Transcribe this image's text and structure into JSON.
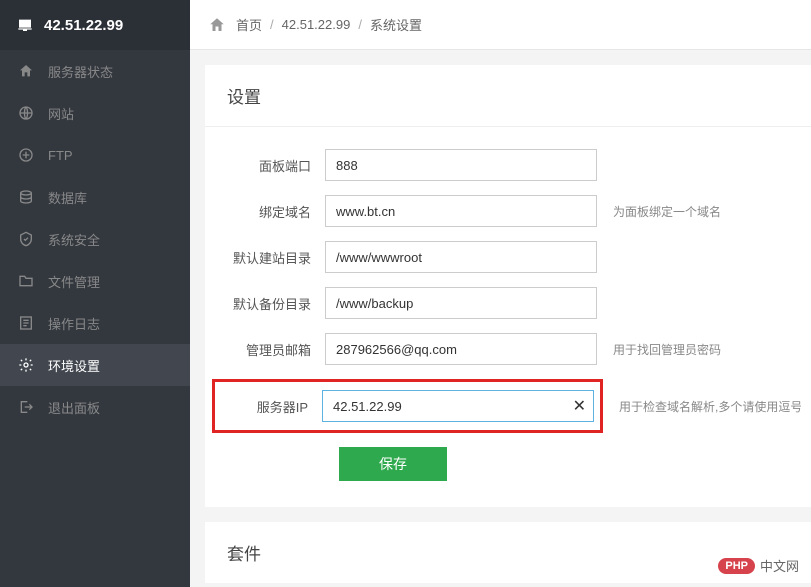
{
  "brand": {
    "title": "42.51.22.99"
  },
  "sidebar": {
    "items": [
      {
        "label": "服务器状态",
        "icon": "dashboard-icon"
      },
      {
        "label": "网站",
        "icon": "globe-icon"
      },
      {
        "label": "FTP",
        "icon": "ftp-icon"
      },
      {
        "label": "数据库",
        "icon": "database-icon"
      },
      {
        "label": "系统安全",
        "icon": "shield-icon"
      },
      {
        "label": "文件管理",
        "icon": "folder-icon"
      },
      {
        "label": "操作日志",
        "icon": "log-icon"
      },
      {
        "label": "环境设置",
        "icon": "gear-icon"
      },
      {
        "label": "退出面板",
        "icon": "exit-icon"
      }
    ]
  },
  "breadcrumb": {
    "home": "首页",
    "ip": "42.51.22.99",
    "page": "系统设置"
  },
  "panel": {
    "title": "设置",
    "fields": {
      "port": {
        "label": "面板端口",
        "value": "888",
        "hint": ""
      },
      "domain": {
        "label": "绑定域名",
        "value": "www.bt.cn",
        "hint": "为面板绑定一个域名"
      },
      "site": {
        "label": "默认建站目录",
        "value": "/www/wwwroot",
        "hint": ""
      },
      "backup": {
        "label": "默认备份目录",
        "value": "/www/backup",
        "hint": ""
      },
      "email": {
        "label": "管理员邮箱",
        "value": "287962566@qq.com",
        "hint": "用于找回管理员密码"
      },
      "ip": {
        "label": "服务器IP",
        "value": "42.51.22.99",
        "hint": "用于检查域名解析,多个请使用逗号隔"
      }
    },
    "save_label": "保存"
  },
  "sub_panel": {
    "title": "套件"
  },
  "footer_logo": {
    "php": "PHP",
    "txt": "中文网"
  }
}
